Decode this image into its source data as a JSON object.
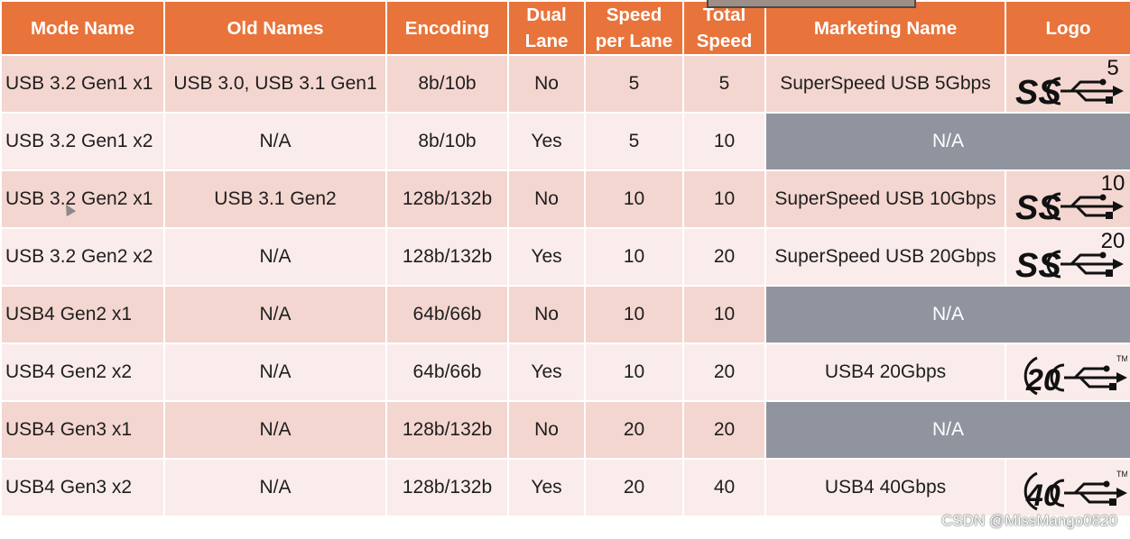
{
  "headers": {
    "mode_name": "Mode Name",
    "old_names": "Old Names",
    "encoding": "Encoding",
    "dual_lane_1": "Dual",
    "dual_lane_2": "Lane",
    "speed_per_lane_1": "Speed",
    "speed_per_lane_2": "per Lane",
    "total_speed_1": "Total",
    "total_speed_2": "Speed",
    "marketing_name": "Marketing Name",
    "logo": "Logo"
  },
  "rows": [
    {
      "mode": "USB 3.2 Gen1 x1",
      "old": "USB 3.0, USB 3.1 Gen1",
      "enc": "8b/10b",
      "dual": "No",
      "lane": "5",
      "total": "5",
      "marketing": "SuperSpeed USB 5Gbps",
      "logo_text": "SS",
      "logo_num": "5"
    },
    {
      "mode": "USB 3.2 Gen1 x2",
      "old": "N/A",
      "enc": "8b/10b",
      "dual": "Yes",
      "lane": "5",
      "total": "10",
      "marketing": "N/A",
      "logo_text": "",
      "logo_num": ""
    },
    {
      "mode": "USB 3.2 Gen2 x1",
      "old": "USB 3.1 Gen2",
      "enc": "128b/132b",
      "dual": "No",
      "lane": "10",
      "total": "10",
      "marketing": "SuperSpeed USB 10Gbps",
      "logo_text": "SS",
      "logo_num": "10"
    },
    {
      "mode": "USB 3.2 Gen2 x2",
      "old": "N/A",
      "enc": "128b/132b",
      "dual": "Yes",
      "lane": "10",
      "total": "20",
      "marketing": "SuperSpeed USB 20Gbps",
      "logo_text": "SS",
      "logo_num": "20"
    },
    {
      "mode": "USB4 Gen2 x1",
      "old": "N/A",
      "enc": "64b/66b",
      "dual": "No",
      "lane": "10",
      "total": "10",
      "marketing": "N/A",
      "logo_text": "",
      "logo_num": ""
    },
    {
      "mode": "USB4 Gen2 x2",
      "old": "N/A",
      "enc": "64b/66b",
      "dual": "Yes",
      "lane": "10",
      "total": "20",
      "marketing": "USB4 20Gbps",
      "logo_text": "20",
      "logo_num": "TM"
    },
    {
      "mode": "USB4 Gen3 x1",
      "old": "N/A",
      "enc": "128b/132b",
      "dual": "No",
      "lane": "20",
      "total": "20",
      "marketing": "N/A",
      "logo_text": "",
      "logo_num": ""
    },
    {
      "mode": "USB4 Gen3 x2",
      "old": "N/A",
      "enc": "128b/132b",
      "dual": "Yes",
      "lane": "20",
      "total": "40",
      "marketing": "USB4 40Gbps",
      "logo_text": "40",
      "logo_num": "TM"
    }
  ],
  "watermark": "CSDN @MissMango0820",
  "colors": {
    "header": "#e8743b",
    "row_dark": "#f4d6d0",
    "row_light": "#faeceb",
    "na_fill": "#8f949e"
  }
}
